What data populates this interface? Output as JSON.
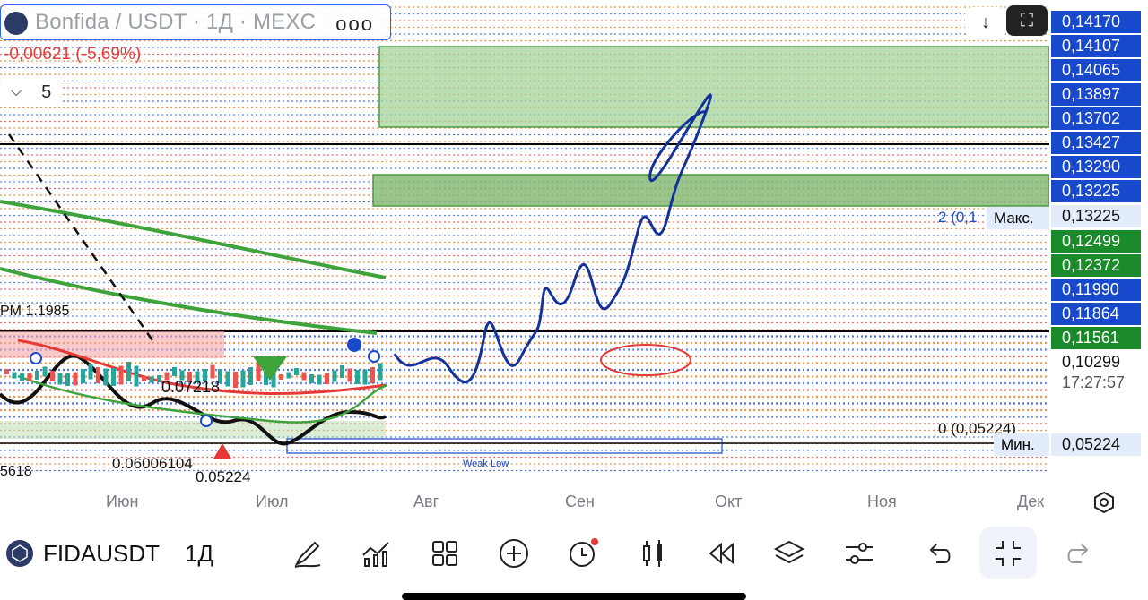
{
  "symbol_bar": {
    "title": "Bonfida / USDT · 1Д · MEXC",
    "menu": "ooo"
  },
  "change_text": "-0,00621 (-5,69%)",
  "interval_selector": {
    "value": "5"
  },
  "buttons": {
    "download": "↓",
    "fullscreen": "⛶"
  },
  "price_scale": [
    {
      "value": "0,14170",
      "bg": "#1848cc",
      "fg": "#ffffff"
    },
    {
      "value": "0,14107",
      "bg": "#1848cc",
      "fg": "#ffffff"
    },
    {
      "value": "0,14065",
      "bg": "#1848cc",
      "fg": "#ffffff"
    },
    {
      "value": "0,13897",
      "bg": "#1848cc",
      "fg": "#ffffff"
    },
    {
      "value": "0,13702",
      "bg": "#1848cc",
      "fg": "#ffffff"
    },
    {
      "value": "0,13427",
      "bg": "#1848cc",
      "fg": "#ffffff"
    },
    {
      "value": "0,13290",
      "bg": "#1848cc",
      "fg": "#ffffff"
    },
    {
      "value": "0,13225",
      "bg": "#1848cc",
      "fg": "#ffffff"
    },
    {
      "value": "0,13225",
      "bg": "#e3ecfb",
      "fg": "#111111"
    },
    {
      "value": "0,12499",
      "bg": "#1b8a2a",
      "fg": "#ffffff"
    },
    {
      "value": "0,12372",
      "bg": "#1b8a2a",
      "fg": "#ffffff"
    },
    {
      "value": "0,11990",
      "bg": "#1848cc",
      "fg": "#ffffff"
    },
    {
      "value": "0,11864",
      "bg": "#1848cc",
      "fg": "#ffffff"
    },
    {
      "value": "0,11561",
      "bg": "#1b8a2a",
      "fg": "#ffffff"
    },
    {
      "value": "0,10299",
      "bg": "#ffffff",
      "fg": "#111111"
    },
    {
      "value": "17:27:57",
      "bg": "#ffffff",
      "fg": "#555555"
    },
    {
      "value": "0,05224",
      "bg": "#e3ecfb",
      "fg": "#111111"
    }
  ],
  "max_label": "Макс.",
  "min_label": "Мин.",
  "chart_text": {
    "weak_low": "Weak Low",
    "price_072": "0.07218",
    "price_060": "0.06006104",
    "price_052": "0.05224",
    "price_1985": "PM 1.1985",
    "left_5618": "5618",
    "fib_1": "2 (0,1",
    "fib_2": "0 (0,05224)"
  },
  "time_axis": [
    "Июн",
    "Июл",
    "Авг",
    "Сен",
    "Окт",
    "Ноя",
    "Дек"
  ],
  "bottom_bar": {
    "symbol": "FIDAUSDT",
    "interval": "1Д"
  },
  "colors": {
    "accent": "#2962ff",
    "green_zone": "#5aa64f",
    "drawing": "#13329a",
    "red": "#e53935"
  }
}
